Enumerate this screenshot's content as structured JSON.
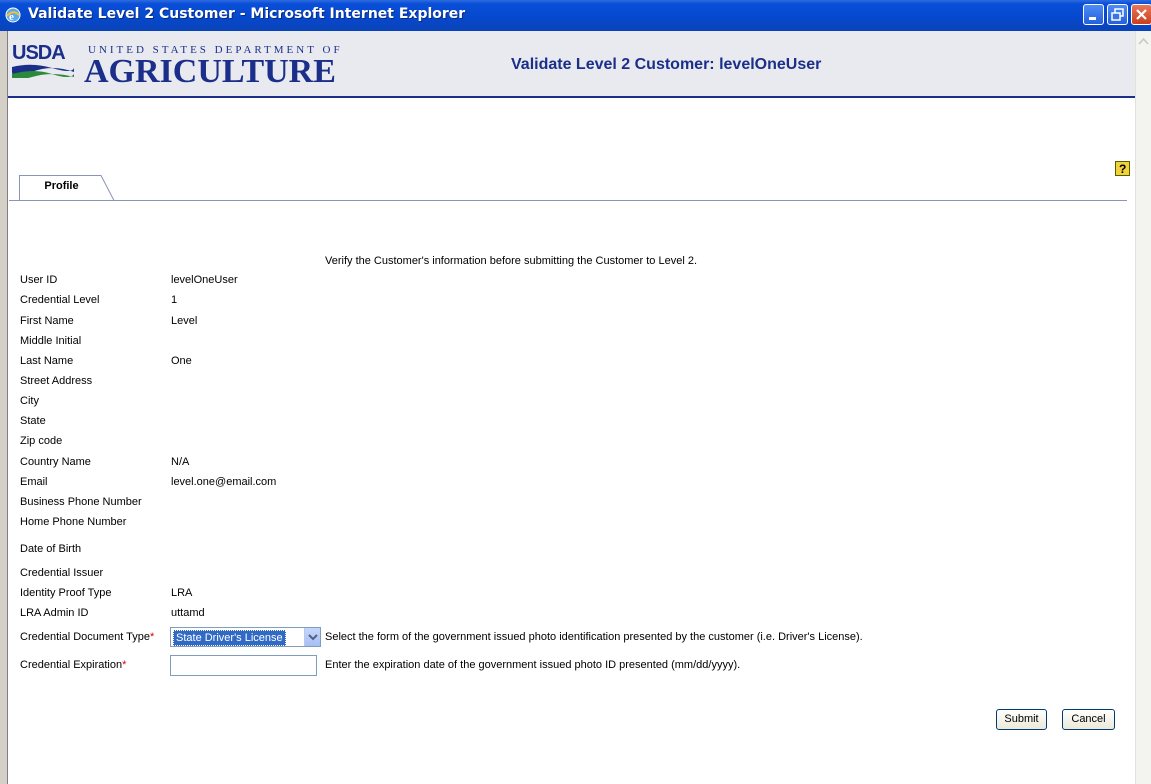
{
  "window": {
    "title": "Validate Level 2 Customer - Microsoft Internet Explorer"
  },
  "header": {
    "logo_usda": "USDA",
    "logo_dept": "UNITED STATES DEPARTMENT OF",
    "logo_agri": "AGRICULTURE",
    "page_title": "Validate Level 2 Customer: levelOneUser"
  },
  "tabs": [
    {
      "label": "Profile",
      "active": true
    }
  ],
  "intro": "Verify the Customer's information before submitting the Customer to Level 2.",
  "fields": [
    {
      "label": "User ID",
      "value": "levelOneUser"
    },
    {
      "label": "Credential Level",
      "value": "1"
    },
    {
      "label": "First Name",
      "value": "Level"
    },
    {
      "label": "Middle Initial",
      "value": ""
    },
    {
      "label": "Last Name",
      "value": "One"
    },
    {
      "label": "Street Address",
      "value": ""
    },
    {
      "label": "City",
      "value": ""
    },
    {
      "label": "State",
      "value": ""
    },
    {
      "label": "Zip code",
      "value": ""
    },
    {
      "label": "Country Name",
      "value": "N/A"
    },
    {
      "label": "Email",
      "value": "level.one@email.com"
    },
    {
      "label": "Business Phone Number",
      "value": ""
    },
    {
      "label": "Home Phone Number",
      "value": ""
    },
    {
      "label": "Date of Birth",
      "value": ""
    },
    {
      "label": "Credential Issuer",
      "value": ""
    },
    {
      "label": "Identity Proof Type",
      "value": "LRA"
    },
    {
      "label": "LRA Admin ID",
      "value": "uttamd"
    }
  ],
  "credential_document": {
    "label": "Credential Document Type",
    "required_mark": "*",
    "selected": "State Driver's License",
    "hint": "Select the form of the government issued photo identification presented by the customer (i.e. Driver's License)."
  },
  "credential_expiration": {
    "label": "Credential Expiration",
    "required_mark": "*",
    "value": "",
    "hint": "Enter the expiration date of the government issued photo ID presented (mm/dd/yyyy)."
  },
  "buttons": {
    "submit": "Submit",
    "cancel": "Cancel"
  },
  "icons": {
    "window": "ie-icon",
    "help": "help-icon",
    "dropdown": "chevron-down-icon"
  },
  "colors": {
    "title_bar": "#0549d0",
    "brand_blue": "#1b2f8a",
    "selection": "#316ac5",
    "required": "#dd0000"
  }
}
